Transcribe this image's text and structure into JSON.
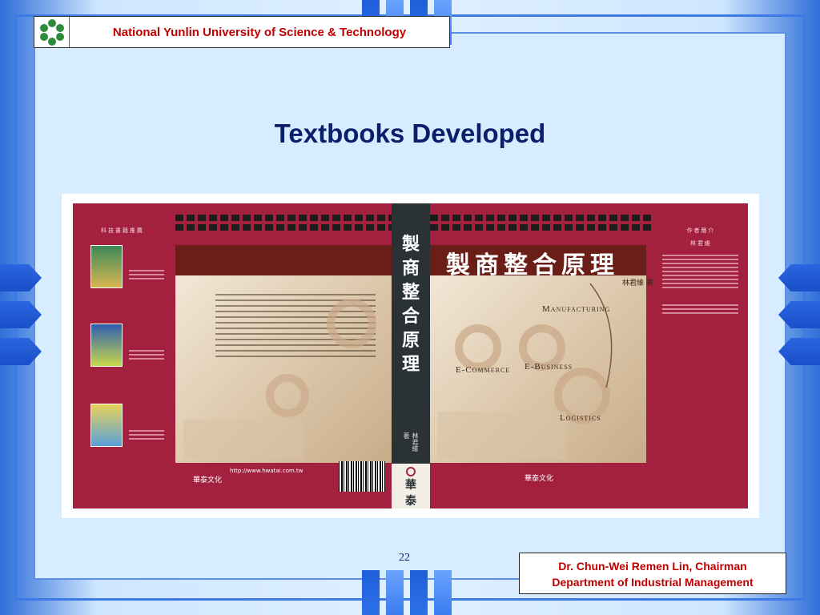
{
  "header": {
    "institution": "National Yunlin University of Science & Technology"
  },
  "slide": {
    "title": "Textbooks Developed",
    "page_number": "22"
  },
  "book_cover": {
    "front_title": "製商整合原理",
    "spine_chars": [
      "製",
      "商",
      "整",
      "合",
      "原",
      "理"
    ],
    "author": "林君維 著",
    "spine_author": "林君維 著",
    "spine_publisher": [
      "華",
      "泰"
    ],
    "labels": [
      "Manufacturing",
      "E-Commerce",
      "E-Business",
      "Logistics"
    ],
    "publisher_name": "華泰文化",
    "back_side_title": "科 技 書 籍 推 薦",
    "front_side_title": "作 者 簡 介",
    "front_side_name": "林 君 維",
    "website": "http://www.hwatai.com.tw"
  },
  "footer": {
    "line1": "Dr. Chun-Wei Remen Lin, Chairman",
    "line2": "Department of Industrial Management"
  },
  "colors": {
    "title": "#0a1f6b",
    "header_text": "#c00000",
    "cover_red": "#a3213f",
    "spine": "#2b3236",
    "accent_blue": "#2f6fd8"
  }
}
